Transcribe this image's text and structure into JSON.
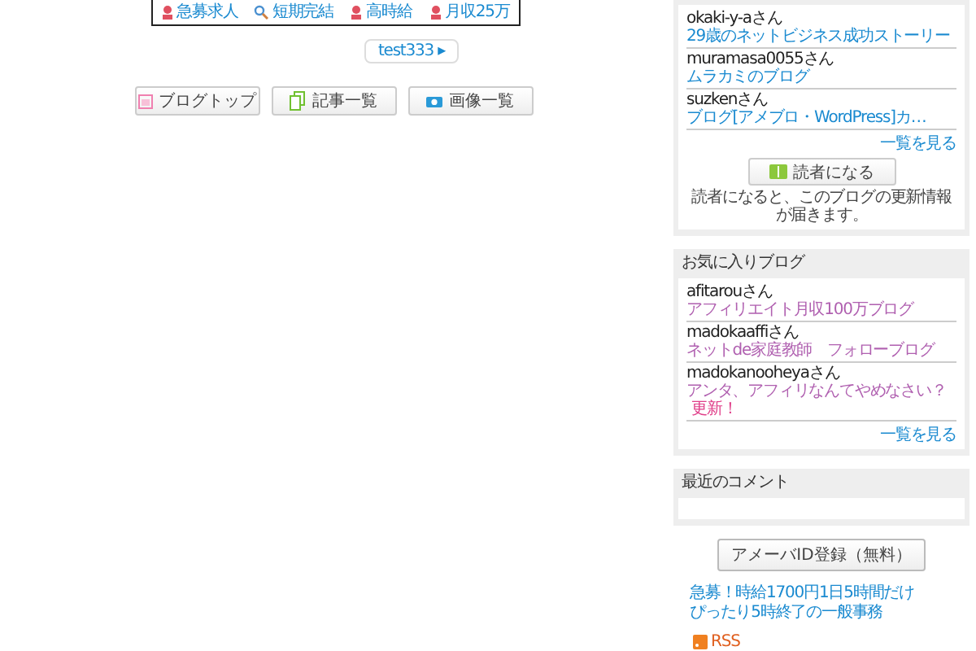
{
  "job_links": [
    {
      "label": "急募求人"
    },
    {
      "label": "短期完結"
    },
    {
      "label": "高時給"
    },
    {
      "label": "月収25万"
    }
  ],
  "tag": "test333 ▸",
  "nav_buttons": [
    {
      "label": "ブログトップ"
    },
    {
      "label": "記事一覧"
    },
    {
      "label": "画像一覧"
    }
  ],
  "readers": {
    "items": [
      {
        "user": "okaki-y-aさん",
        "blog": "29歳のネットビジネス成功ストーリー"
      },
      {
        "user": "muramasa0055さん",
        "blog": "ムラカミのブログ"
      },
      {
        "user": "suzkenさん",
        "blog": "ブログ[アメブロ・WordPress]カ…"
      }
    ],
    "more": "一覧を見る",
    "button": "読者になる",
    "note": "読者になると、このブログの更新情報が届きます。"
  },
  "favorites": {
    "title": "お気に入りブログ",
    "items": [
      {
        "user": "afitarouさん",
        "blog": "アフィリエイト月収100万ブログ"
      },
      {
        "user": "madokaaffiさん",
        "blog": "ネットde家庭教師　フォローブログ"
      },
      {
        "user": "madokanooheyaさん",
        "blog": "アンタ、アフィリなんてやめなさい？",
        "badge": "更新！"
      }
    ],
    "more": "一覧を見る"
  },
  "comments": {
    "title": "最近のコメント"
  },
  "register_button": "アメーバID登録（無料）",
  "promo_links": [
    "急募！時給1700円1日5時間だけ",
    "ぴったり5時終了の一般事務"
  ],
  "rss": "RSS"
}
